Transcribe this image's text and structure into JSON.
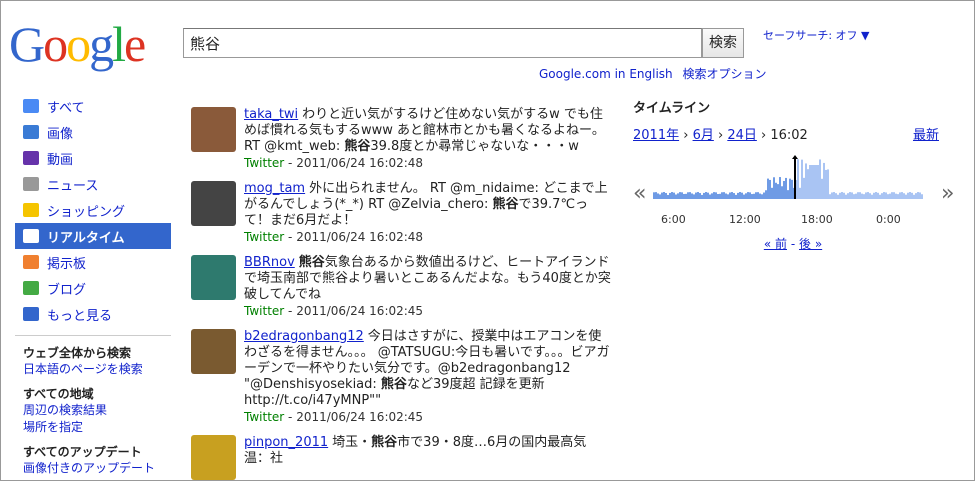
{
  "logo": {
    "letters": [
      "G",
      "o",
      "o",
      "g",
      "l",
      "e"
    ],
    "colors": [
      "#3366cc",
      "#dd3322",
      "#ffbb00",
      "#3366cc",
      "#22aa44",
      "#dd3322"
    ]
  },
  "search": {
    "query": "熊谷",
    "button": "検索"
  },
  "safesearch": "セーフサーチ: オフ ▼",
  "sublinks": [
    "Google.com in English",
    "検索オプション"
  ],
  "nav": [
    {
      "label": "すべて",
      "icon": "google-plus-icon",
      "color": "#4a8af4"
    },
    {
      "label": "画像",
      "icon": "camera-icon",
      "color": "#3a7bd5"
    },
    {
      "label": "動画",
      "icon": "film-icon",
      "color": "#6633aa"
    },
    {
      "label": "ニュース",
      "icon": "newspaper-icon",
      "color": "#999999"
    },
    {
      "label": "ショッピング",
      "icon": "tag-icon",
      "color": "#f5c400"
    },
    {
      "label": "リアルタイム",
      "icon": "speech-bubble-icon",
      "color": "#ffffff",
      "active": true
    },
    {
      "label": "掲示板",
      "icon": "forum-icon",
      "color": "#f08030"
    },
    {
      "label": "ブログ",
      "icon": "blog-icon",
      "color": "#44aa44"
    },
    {
      "label": "もっと見る",
      "icon": "chevron-down-icon",
      "color": "#3366cc"
    }
  ],
  "sections": [
    {
      "heading": "ウェブ全体から検索",
      "links": [
        "日本語のページを検索"
      ]
    },
    {
      "heading": "すべての地域",
      "links": [
        "周辺の検索結果",
        "場所を指定"
      ]
    },
    {
      "heading": "すべてのアップデート",
      "links": [
        "画像付きのアップデート"
      ]
    }
  ],
  "results": [
    {
      "user": "taka_twi",
      "pre": "わりと近い気がするけど住めない気がするw でも住めば慣れる気もするwww あと館林市とかも暑くなるよねー。RT @kmt_web: ",
      "kw": "熊谷",
      "post": "39.8度とか尋常じゃないな・・・w",
      "source": "Twitter",
      "time": "- 2011/06/24 16:02:48",
      "avatar": "#8a5a3a"
    },
    {
      "user": "mog_tam",
      "pre": "外に出られません。 RT @m_nidaime: どこまで上がるんでしょう(*_*) RT @Zelvia_chero: ",
      "kw": "熊谷",
      "post": "で39.7℃って！まだ6月だよ！",
      "source": "Twitter",
      "time": "- 2011/06/24 16:02:48",
      "avatar": "#444444"
    },
    {
      "user": "BBRnov",
      "pre": "",
      "kw": "熊谷",
      "post": "気象台あるから数値出るけど、ヒートアイランドで埼玉南部で熊谷より暑いとこあるんだよな。もう40度とか突破してんでね",
      "source": "Twitter",
      "time": "- 2011/06/24 16:02:45",
      "avatar": "#2e7a6e"
    },
    {
      "user": "b2edragonbang12",
      "pre": "今日はさすがに、授業中はエアコンを使わざるを得ません。。。 @TATSUGU:今日も暑いです。。。ビアガーデンで一杯やりたい気分です。@b2edragonbang12 \"@Denshisyosekiad: ",
      "kw": "熊谷",
      "post": "など39度超 記録を更新 http://t.co/i47yMNP\"\"",
      "source": "Twitter",
      "time": "- 2011/06/24 16:02:45",
      "avatar": "#7a5a30"
    },
    {
      "user": "pinpon_2011",
      "pre": "埼玉・",
      "kw": "熊谷",
      "post": "市で39・8度…6月の国内最高気温：社",
      "source": "",
      "time": "",
      "avatar": "#c8a020"
    }
  ],
  "timeline": {
    "title": "タイムライン",
    "path": [
      "2011年",
      "6月",
      "24日"
    ],
    "current": "16:02",
    "latest": "最新",
    "ticks": [
      "6:00",
      "12:00",
      "18:00",
      "0:00"
    ],
    "prev": "« 前",
    "sep": "-",
    "next": "後 »"
  }
}
